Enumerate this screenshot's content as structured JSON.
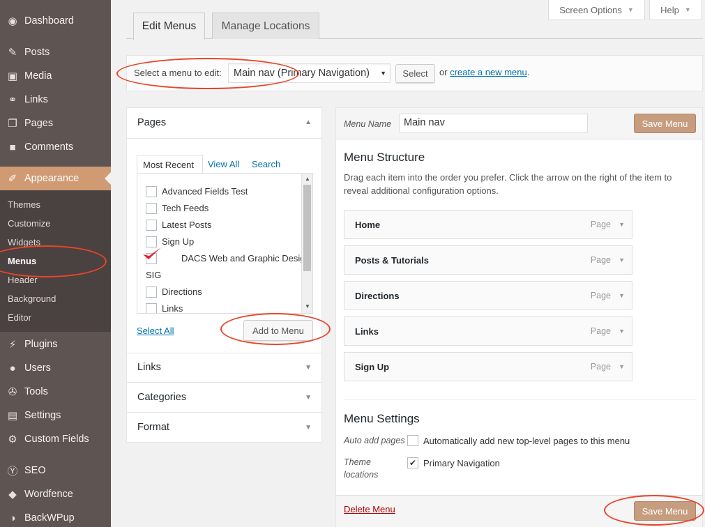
{
  "sidebar": {
    "items": [
      {
        "label": "Dashboard",
        "icon": "dashboard-icon",
        "glyph": "◉"
      },
      {
        "label": "Posts",
        "icon": "pin-icon",
        "glyph": "✎"
      },
      {
        "label": "Media",
        "icon": "media-icon",
        "glyph": "▣"
      },
      {
        "label": "Links",
        "icon": "link-icon",
        "glyph": "⚭"
      },
      {
        "label": "Pages",
        "icon": "pages-icon",
        "glyph": "❐"
      },
      {
        "label": "Comments",
        "icon": "comment-icon",
        "glyph": "■"
      },
      {
        "label": "Appearance",
        "icon": "brush-icon",
        "glyph": "✐"
      },
      {
        "label": "Plugins",
        "icon": "plugin-icon",
        "glyph": "⚡"
      },
      {
        "label": "Users",
        "icon": "user-icon",
        "glyph": "●"
      },
      {
        "label": "Tools",
        "icon": "wrench-icon",
        "glyph": "✇"
      },
      {
        "label": "Settings",
        "icon": "settings-icon",
        "glyph": "▤"
      },
      {
        "label": "Custom Fields",
        "icon": "gear-icon",
        "glyph": "⚙"
      },
      {
        "label": "SEO",
        "icon": "seo-icon",
        "glyph": "Ⓨ"
      },
      {
        "label": "Wordfence",
        "icon": "wordfence-icon",
        "glyph": "◆"
      },
      {
        "label": "BackWPup",
        "icon": "backup-icon",
        "glyph": "◑"
      }
    ],
    "submenu": [
      "Themes",
      "Customize",
      "Widgets",
      "Menus",
      "Header",
      "Background",
      "Editor"
    ]
  },
  "top": {
    "screen_options": "Screen Options",
    "help": "Help"
  },
  "tabs": {
    "edit": "Edit Menus",
    "locations": "Manage Locations"
  },
  "select_bar": {
    "label": "Select a menu to edit:",
    "selected": "Main nav (Primary Navigation)",
    "select_button": "Select",
    "or_text": "or",
    "create_link": "create a new menu",
    "period": "."
  },
  "pages_panel": {
    "title": "Pages",
    "tabs": [
      "Most Recent",
      "View All",
      "Search"
    ],
    "items": [
      {
        "label": "Advanced Fields Test",
        "checked": false
      },
      {
        "label": "Tech Feeds",
        "checked": false
      },
      {
        "label": "Latest Posts",
        "checked": false
      },
      {
        "label": "Sign Up",
        "checked": false
      },
      {
        "label": "DACS Web and Graphic Design",
        "checked": true
      },
      {
        "label": "SIG",
        "checked": false
      },
      {
        "label": "Directions",
        "checked": false
      },
      {
        "label": "Links",
        "checked": false
      }
    ],
    "select_all": "Select All",
    "add_button": "Add to Menu"
  },
  "accordions": [
    "Links",
    "Categories",
    "Format"
  ],
  "editor": {
    "menu_name_label": "Menu Name",
    "menu_name_value": "Main nav",
    "save_button": "Save Menu",
    "structure_title": "Menu Structure",
    "structure_help": "Drag each item into the order you prefer. Click the arrow on the right of the item to reveal additional configuration options.",
    "items": [
      {
        "title": "Home",
        "type": "Page"
      },
      {
        "title": "Posts & Tutorials",
        "type": "Page"
      },
      {
        "title": "Directions",
        "type": "Page"
      },
      {
        "title": "Links",
        "type": "Page"
      },
      {
        "title": "Sign Up",
        "type": "Page"
      }
    ],
    "settings_title": "Menu Settings",
    "auto_add_label": "Auto add pages",
    "auto_add_text": "Automatically add new top-level pages to this menu",
    "theme_loc_label_1": "Theme",
    "theme_loc_label_2": "locations",
    "primary_nav": "Primary Navigation",
    "delete_link": "Delete Menu"
  },
  "colors": {
    "sidebar": "#5e5451",
    "accent": "#d09a73",
    "annotation": "#e8452a",
    "link": "#0073aa"
  }
}
